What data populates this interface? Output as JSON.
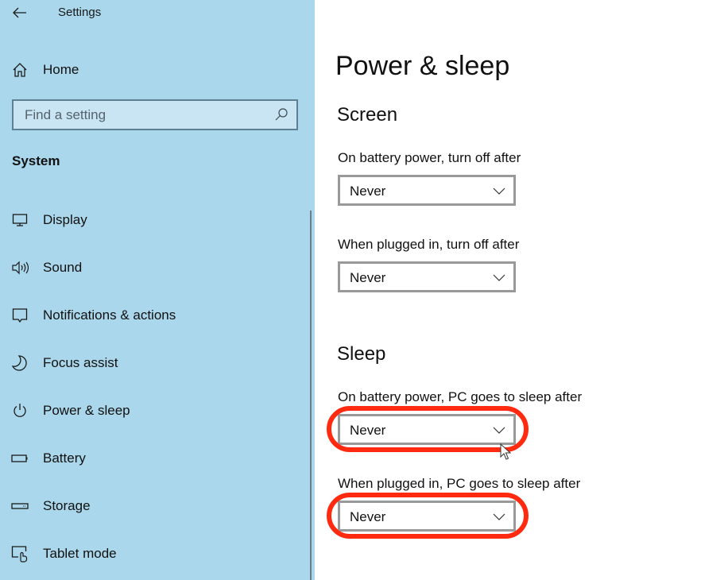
{
  "window": {
    "title": "Settings",
    "back_icon": "back-arrow-icon"
  },
  "sidebar": {
    "home": {
      "label": "Home",
      "icon": "home-icon"
    },
    "search": {
      "placeholder": "Find a setting",
      "value": "",
      "icon": "search-icon"
    },
    "section_label": "System",
    "items": [
      {
        "label": "Display",
        "icon": "monitor-icon"
      },
      {
        "label": "Sound",
        "icon": "speaker-icon"
      },
      {
        "label": "Notifications & actions",
        "icon": "notification-icon"
      },
      {
        "label": "Focus assist",
        "icon": "moon-icon"
      },
      {
        "label": "Power & sleep",
        "icon": "power-icon"
      },
      {
        "label": "Battery",
        "icon": "battery-icon"
      },
      {
        "label": "Storage",
        "icon": "storage-icon"
      },
      {
        "label": "Tablet mode",
        "icon": "tablet-mode-icon"
      }
    ]
  },
  "main": {
    "page_title": "Power & sleep",
    "screen": {
      "title": "Screen",
      "battery_label": "On battery power, turn off after",
      "battery_value": "Never",
      "plugged_label": "When plugged in, turn off after",
      "plugged_value": "Never"
    },
    "sleep": {
      "title": "Sleep",
      "battery_label": "On battery power, PC goes to sleep after",
      "battery_value": "Never",
      "plugged_label": "When plugged in, PC goes to sleep after",
      "plugged_value": "Never"
    }
  },
  "annotations": {
    "highlight_color": "#ff2a10"
  }
}
